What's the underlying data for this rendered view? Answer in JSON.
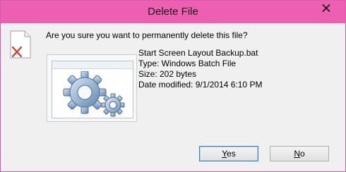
{
  "window": {
    "title": "Delete File"
  },
  "dialog": {
    "question": "Are you sure you want to permanently delete this file?",
    "file_icon": "deleted-file-icon",
    "thumbnail_icon": "gears-icon",
    "file": {
      "name": "Start Screen Layout Backup.bat",
      "type": "Type: Windows Batch File",
      "size": "Size: 202 bytes",
      "modified": "Date modified: 9/1/2014 6:10 PM"
    }
  },
  "buttons": {
    "yes_mnemonic": "Y",
    "yes_rest": "es",
    "no_mnemonic": "N",
    "no_rest": "o"
  },
  "colors": {
    "titlebar": "#ec5fb1",
    "background": "#f0f0f0",
    "close_x": "#1a1a1a"
  }
}
